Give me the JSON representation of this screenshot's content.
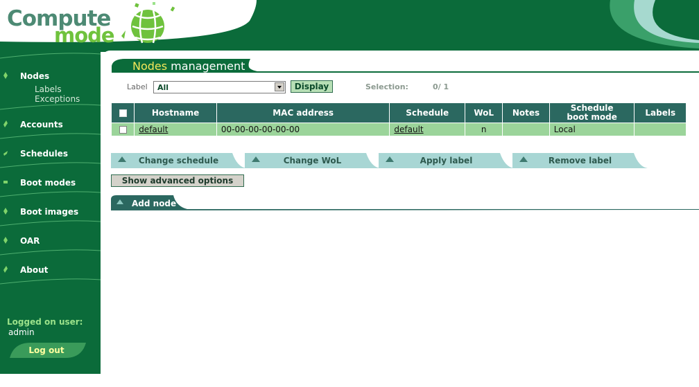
{
  "brand": {
    "word1": "Compute",
    "word2": "mode"
  },
  "sidebar": {
    "items": [
      {
        "label": "Nodes",
        "subitems": [
          "Labels",
          "Exceptions"
        ]
      },
      {
        "label": "Accounts"
      },
      {
        "label": "Schedules"
      },
      {
        "label": "Boot modes"
      },
      {
        "label": "Boot images"
      },
      {
        "label": "OAR"
      },
      {
        "label": "About"
      }
    ],
    "logged_label": "Logged on user:",
    "user": "admin",
    "logout_label": "Log out"
  },
  "page": {
    "title_highlight": "Nodes",
    "title_rest": " management"
  },
  "filter": {
    "label_caption": "Label",
    "label_value": "All",
    "display_label": "Display",
    "selection_caption": "Selection:",
    "selection_value": "0/ 1"
  },
  "table": {
    "headers": [
      "Hostname",
      "MAC address",
      "Schedule",
      "WoL",
      "Notes",
      "Schedule boot mode",
      "Labels"
    ],
    "headers_boot_line1": "Schedule",
    "headers_boot_line2": "boot mode",
    "rows": [
      {
        "hostname": "default",
        "mac": "00-00-00-00-00-00",
        "schedule": "default",
        "wol": "n",
        "notes": "",
        "boot_mode": "Local",
        "labels": ""
      }
    ]
  },
  "actions": {
    "change_schedule": "Change schedule",
    "change_wol": "Change WoL",
    "apply_label": "Apply label",
    "remove_label": "Remove label"
  },
  "advanced_label": "Show advanced options",
  "add_node_label": "Add node",
  "colors": {
    "dark_green": "#0b6b3a",
    "table_header": "#2b6860",
    "row": "#9bd49a",
    "tab": "#a8d6d4",
    "accent_yellow": "#f5e85a"
  }
}
